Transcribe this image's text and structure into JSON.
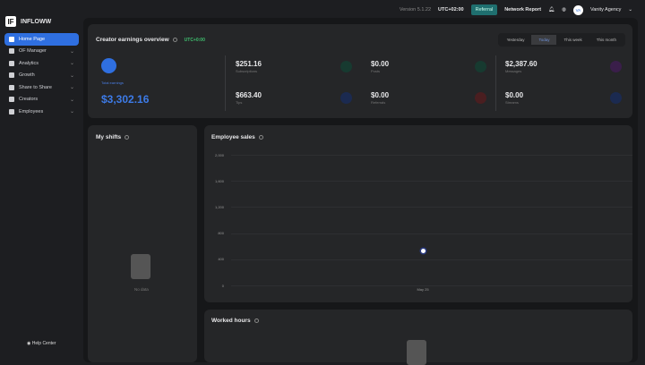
{
  "app": {
    "name": "INFLOWW",
    "logo": "IF"
  },
  "topbar": {
    "version": "Version 5.1.22",
    "timezone": "UTC+02:00",
    "referral": "Referral",
    "network_report": "Network Report",
    "user_initials": "VA",
    "user_name": "Vanity Agency"
  },
  "sidebar": {
    "items": [
      {
        "label": "Home Page"
      },
      {
        "label": "OF Manager"
      },
      {
        "label": "Analytics"
      },
      {
        "label": "Growth"
      },
      {
        "label": "Share to Share"
      },
      {
        "label": "Creators"
      },
      {
        "label": "Employees"
      }
    ],
    "help": "Help Center"
  },
  "overview": {
    "title": "Creator earnings overview",
    "tz": "UTC+0:00",
    "tabs": [
      "Yesterday",
      "Today",
      "This week",
      "This month"
    ],
    "selected_tab": "Today",
    "total_label": "Total earnings",
    "total": "$3,302.16",
    "stats": [
      {
        "value": "$251.16",
        "label": "Subscriptions"
      },
      {
        "value": "$663.40",
        "label": "Tips"
      },
      {
        "value": "$0.00",
        "label": "Posts"
      },
      {
        "value": "$0.00",
        "label": "Referrals"
      },
      {
        "value": "$2,387.60",
        "label": "Messages"
      },
      {
        "value": "$0.00",
        "label": "Streams"
      }
    ]
  },
  "shifts": {
    "title": "My shifts",
    "empty": "No data"
  },
  "worked": {
    "title": "Worked hours"
  },
  "chart_data": {
    "type": "scatter",
    "title": "Employee sales",
    "categories": [
      "May 25"
    ],
    "values": [
      530
    ],
    "ylim": [
      0,
      2000
    ],
    "yticks": [
      "2,000",
      "1,600",
      "1,200",
      "800",
      "400",
      "0"
    ],
    "ytick_values": [
      2000,
      1600,
      1200,
      800,
      400,
      0
    ],
    "grid": true
  }
}
